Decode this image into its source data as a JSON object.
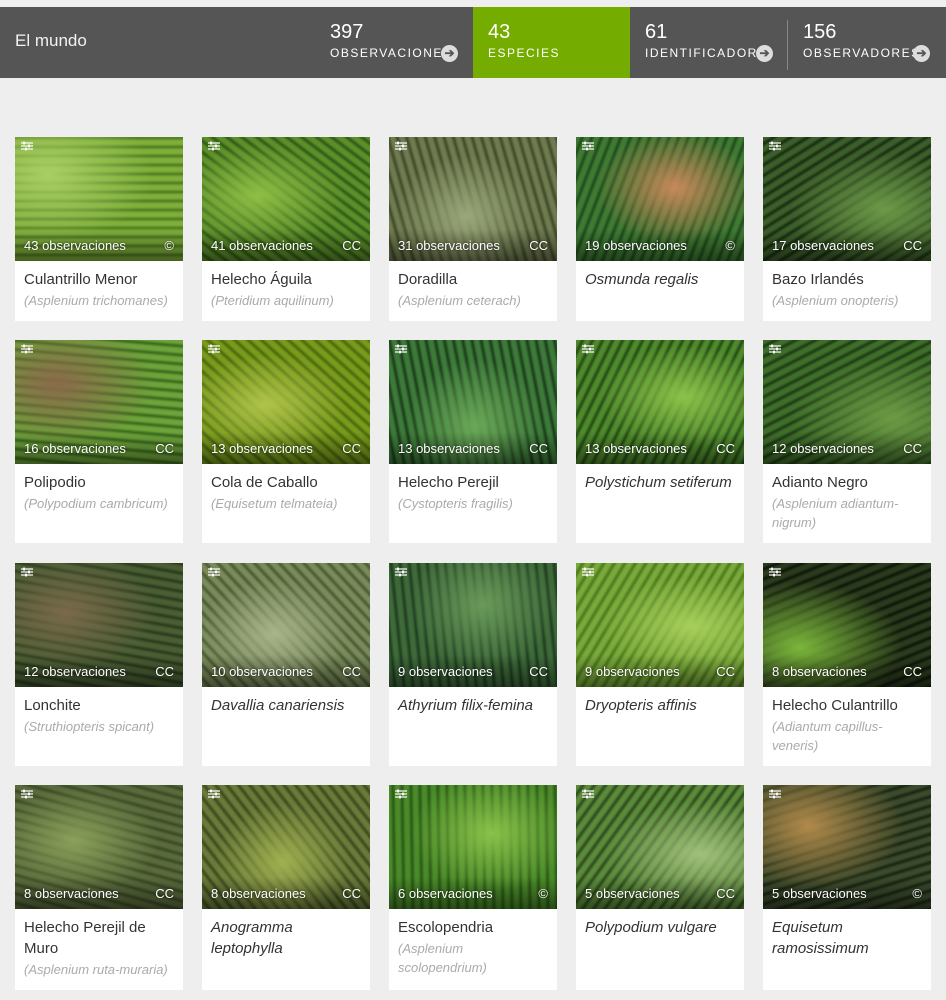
{
  "header": {
    "place": "El mundo",
    "stats": [
      {
        "count": "397",
        "label": "OBSERVACIONES",
        "active": false
      },
      {
        "count": "43",
        "label": "ESPECIES",
        "active": true
      },
      {
        "count": "61",
        "label": "IDENTIFICADORES",
        "active": false
      },
      {
        "count": "156",
        "label": "OBSERVADORES",
        "active": false
      }
    ]
  },
  "species": [
    {
      "name": "Culantrillo Menor",
      "sci": "(Asplenium trichomanes)",
      "obs": "43 observaciones",
      "license": "©",
      "italic": false
    },
    {
      "name": "Helecho Águila",
      "sci": "(Pteridium aquilinum)",
      "obs": "41 observaciones",
      "license": "CC",
      "italic": false
    },
    {
      "name": "Doradilla",
      "sci": "(Asplenium ceterach)",
      "obs": "31 observaciones",
      "license": "CC",
      "italic": false
    },
    {
      "name": "Osmunda regalis",
      "sci": "",
      "obs": "19 observaciones",
      "license": "©",
      "italic": true
    },
    {
      "name": "Bazo Irlandés",
      "sci": "(Asplenium onopteris)",
      "obs": "17 observaciones",
      "license": "CC",
      "italic": false
    },
    {
      "name": "Polipodio",
      "sci": "(Polypodium cambricum)",
      "obs": "16 observaciones",
      "license": "CC",
      "italic": false
    },
    {
      "name": "Cola de Caballo",
      "sci": "(Equisetum telmateia)",
      "obs": "13 observaciones",
      "license": "CC",
      "italic": false
    },
    {
      "name": "Helecho Perejil",
      "sci": "(Cystopteris fragilis)",
      "obs": "13 observaciones",
      "license": "CC",
      "italic": false
    },
    {
      "name": "Polystichum setiferum",
      "sci": "",
      "obs": "13 observaciones",
      "license": "CC",
      "italic": true
    },
    {
      "name": "Adianto Negro",
      "sci": "(Asplenium adiantum-nigrum)",
      "obs": "12 observaciones",
      "license": "CC",
      "italic": false
    },
    {
      "name": "Lonchite",
      "sci": "(Struthiopteris spicant)",
      "obs": "12 observaciones",
      "license": "CC",
      "italic": false
    },
    {
      "name": "Davallia canariensis",
      "sci": "",
      "obs": "10 observaciones",
      "license": "CC",
      "italic": true
    },
    {
      "name": "Athyrium filix-femina",
      "sci": "",
      "obs": "9 observaciones",
      "license": "CC",
      "italic": true
    },
    {
      "name": "Dryopteris affinis",
      "sci": "",
      "obs": "9 observaciones",
      "license": "CC",
      "italic": true
    },
    {
      "name": "Helecho Culantrillo",
      "sci": "(Adiantum capillus-veneris)",
      "obs": "8 observaciones",
      "license": "CC",
      "italic": false
    },
    {
      "name": "Helecho Perejil de Muro",
      "sci": "(Asplenium ruta-muraria)",
      "obs": "8 observaciones",
      "license": "CC",
      "italic": false
    },
    {
      "name": "Anogramma leptophylla",
      "sci": "",
      "obs": "8 observaciones",
      "license": "CC",
      "italic": true
    },
    {
      "name": "Escolopendria",
      "sci": "(Asplenium scolopendrium)",
      "obs": "6 observaciones",
      "license": "©",
      "italic": false
    },
    {
      "name": "Polypodium vulgare",
      "sci": "",
      "obs": "5 observaciones",
      "license": "CC",
      "italic": true
    },
    {
      "name": "Equisetum ramosissimum",
      "sci": "",
      "obs": "5 observaciones",
      "license": "©",
      "italic": true
    }
  ],
  "photo_colors": [
    [
      "#7fae3a",
      "#4f7d22",
      "#a9cf63"
    ],
    [
      "#5c8e2a",
      "#2f5a14",
      "#8fbf45"
    ],
    [
      "#6f7a4e",
      "#3f4a2b",
      "#9aa77a"
    ],
    [
      "#3f7a33",
      "#1f4b1c",
      "#c8885a"
    ],
    [
      "#3c5e2a",
      "#182c10",
      "#6c9948"
    ],
    [
      "#6da33a",
      "#3a6a1c",
      "#8a6a4a"
    ],
    [
      "#7a9a1c",
      "#4a6a0c",
      "#b0c44a"
    ],
    [
      "#3d7a3a",
      "#1b3d1a",
      "#6aa858"
    ],
    [
      "#4e8a2c",
      "#254a14",
      "#8cc24a"
    ],
    [
      "#3f6e2a",
      "#1e3a14",
      "#6c9a44"
    ],
    [
      "#4a5e34",
      "#2a3a1c",
      "#7a6a4a"
    ],
    [
      "#7a8a5a",
      "#4a5a34",
      "#a8b48a"
    ],
    [
      "#3e6a3a",
      "#1f3d20",
      "#6a9a5a"
    ],
    [
      "#7aa83a",
      "#4a7a1c",
      "#a7cf5a"
    ],
    [
      "#2a3a1c",
      "#0e160a",
      "#7ab63a"
    ],
    [
      "#5a6a3c",
      "#3a4a24",
      "#8aa05a"
    ],
    [
      "#6a7a3a",
      "#3a4a1c",
      "#a0b050"
    ],
    [
      "#4a8a2a",
      "#2a5a14",
      "#8ac24a"
    ],
    [
      "#5a8a3a",
      "#2e4a1c",
      "#a0c07a"
    ],
    [
      "#3a4a2a",
      "#1a2414",
      "#b08a4a"
    ]
  ]
}
